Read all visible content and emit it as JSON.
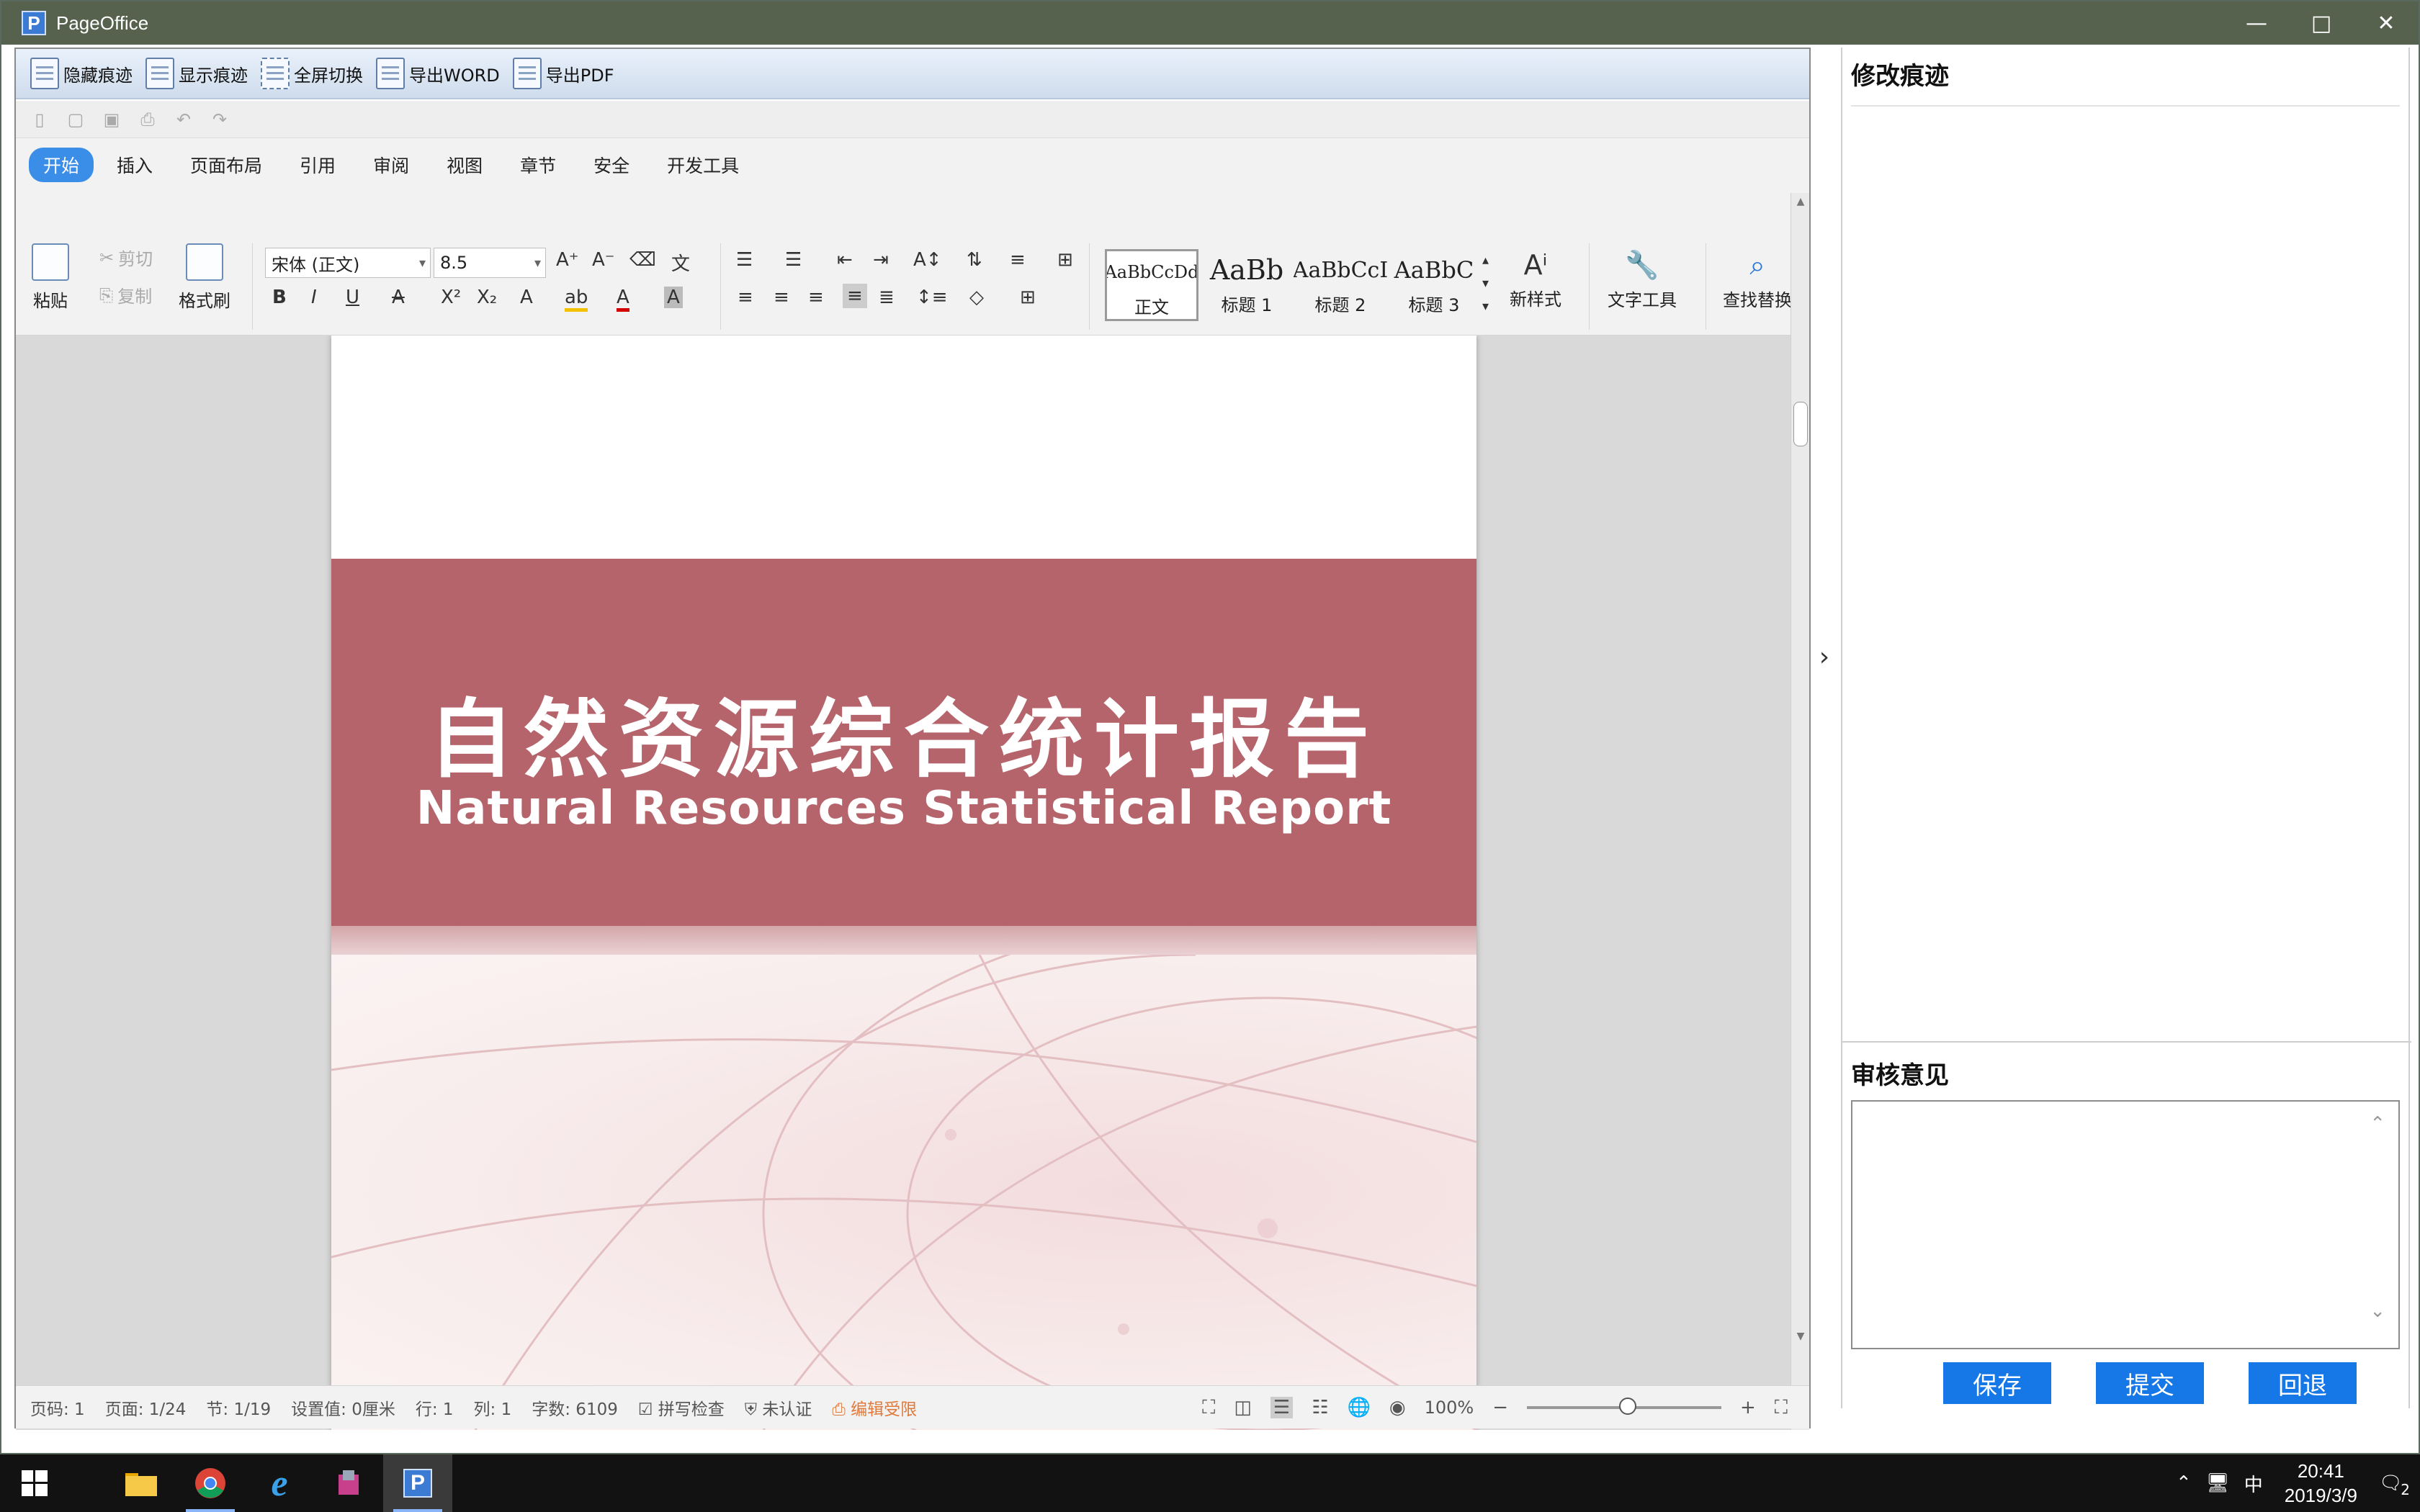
{
  "window": {
    "title": "PageOffice"
  },
  "custom_toolbar": [
    {
      "label": "隐藏痕迹"
    },
    {
      "label": "显示痕迹"
    },
    {
      "label": "全屏切换"
    },
    {
      "label": "导出WORD"
    },
    {
      "label": "导出PDF"
    }
  ],
  "ribbon_tabs": [
    "开始",
    "插入",
    "页面布局",
    "引用",
    "审阅",
    "视图",
    "章节",
    "安全",
    "开发工具"
  ],
  "ribbon": {
    "paste": "粘贴",
    "cut": "剪切",
    "copy": "复制",
    "format_painter": "格式刷",
    "font_name": "宋体 (正文)",
    "font_size": "8.5",
    "styles": [
      {
        "sample": "AaBbCcDd",
        "label": "正文"
      },
      {
        "sample": "AaBb",
        "label": "标题 1"
      },
      {
        "sample": "AaBbCcI",
        "label": "标题 2"
      },
      {
        "sample": "AaBbC",
        "label": "标题 3"
      }
    ],
    "new_style": "新样式",
    "text_tools": "文字工具",
    "find_replace": "查找替换"
  },
  "document": {
    "cover_title": "自然资源综合统计报告",
    "cover_subtitle": "Natural Resources Statistical Report"
  },
  "statusbar": {
    "page_number": "页码: 1",
    "pages": "页面: 1/24",
    "section": "节: 1/19",
    "setting": "设置值: 0厘米",
    "row": "行: 1",
    "col": "列: 1",
    "word_count": "字数: 6109",
    "spell_check": "拼写检查",
    "not_certified": "未认证",
    "edit_restricted": "编辑受限",
    "zoom": "100%"
  },
  "right_panel": {
    "revisions_title": "修改痕迹",
    "review_title": "审核意见",
    "review_text": "",
    "buttons": {
      "save": "保存",
      "submit": "提交",
      "rollback": "回退"
    }
  },
  "taskbar": {
    "time": "20:41",
    "date": "2019/3/9",
    "ime": "中",
    "notifications": "2"
  },
  "colors": {
    "cover_band": "#b6646b",
    "primary_button": "#1677e6",
    "active_tab": "#3b8ee8",
    "titlebar": "#56614e"
  }
}
